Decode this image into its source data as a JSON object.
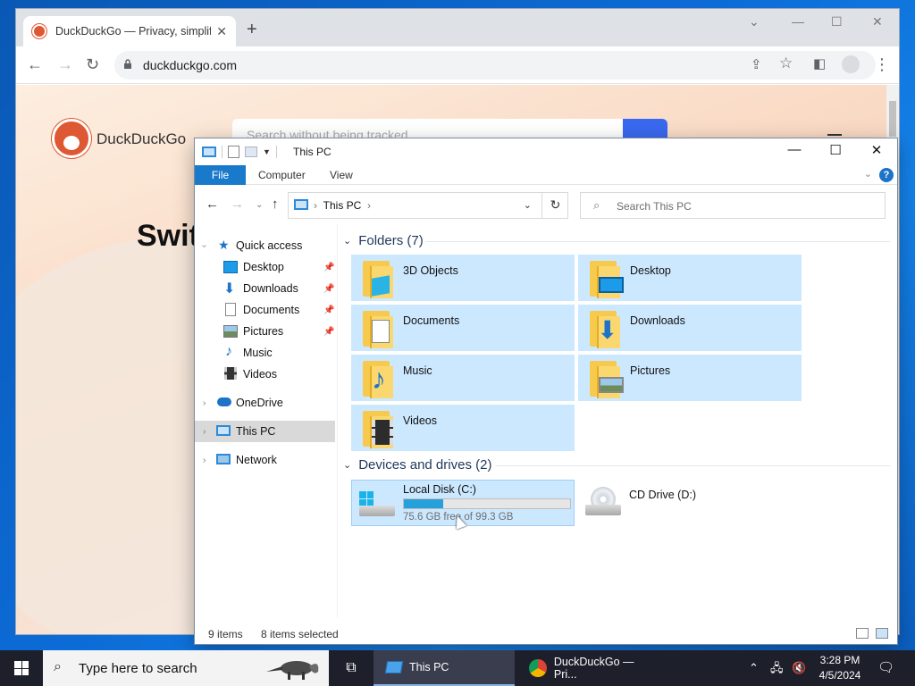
{
  "chrome": {
    "tab_title": "DuckDuckGo — Privacy, simplified",
    "tab_close": "✕",
    "new_tab": "+",
    "url": "duckduckgo.com",
    "page": {
      "brand": "DuckDuckGo",
      "search_placeholder": "Search without being tracked",
      "hero_text": "Swit"
    }
  },
  "explorer": {
    "window_title": "This PC",
    "ribbon": {
      "file": "File",
      "computer": "Computer",
      "view": "View",
      "help": "?"
    },
    "address": {
      "crumb": "This PC"
    },
    "search_placeholder": "Search This PC",
    "nav": [
      {
        "label": "Quick access",
        "icon": "star-icon"
      },
      {
        "label": "Desktop",
        "icon": "desktop-icon",
        "pinned": true
      },
      {
        "label": "Downloads",
        "icon": "download-icon",
        "pinned": true
      },
      {
        "label": "Documents",
        "icon": "document-icon",
        "pinned": true
      },
      {
        "label": "Pictures",
        "icon": "picture-icon",
        "pinned": true
      },
      {
        "label": "Music",
        "icon": "music-icon"
      },
      {
        "label": "Videos",
        "icon": "video-icon"
      },
      {
        "label": "OneDrive",
        "icon": "cloud-icon"
      },
      {
        "label": "This PC",
        "icon": "computer-icon",
        "selected": true
      },
      {
        "label": "Network",
        "icon": "network-icon"
      }
    ],
    "folders_header": "Folders (7)",
    "folders": [
      {
        "label": "3D Objects",
        "icon": "cube-icon"
      },
      {
        "label": "Desktop",
        "icon": "desktop-icon"
      },
      {
        "label": "Documents",
        "icon": "document-icon"
      },
      {
        "label": "Downloads",
        "icon": "download-icon"
      },
      {
        "label": "Music",
        "icon": "music-icon"
      },
      {
        "label": "Pictures",
        "icon": "picture-icon"
      },
      {
        "label": "Videos",
        "icon": "video-icon"
      }
    ],
    "drives_header": "Devices and drives (2)",
    "drives": [
      {
        "label": "Local Disk (C:)",
        "free": "75.6 GB free of 99.3 GB",
        "used_fraction": 0.239,
        "selected": true
      },
      {
        "label": "CD Drive (D:)"
      }
    ],
    "status": {
      "items": "9 items",
      "selected": "8 items selected"
    }
  },
  "taskbar": {
    "search_placeholder": "Type here to search",
    "apps": [
      {
        "label": "This PC",
        "active": true
      },
      {
        "label": "DuckDuckGo — Pri...",
        "active": false
      }
    ],
    "time": "3:28 PM",
    "date": "4/5/2024"
  },
  "colors": {
    "accent": "#1979ca",
    "selection": "#cce8ff",
    "drive_fill": "#26a0da",
    "taskbar": "#1d1f2b"
  }
}
